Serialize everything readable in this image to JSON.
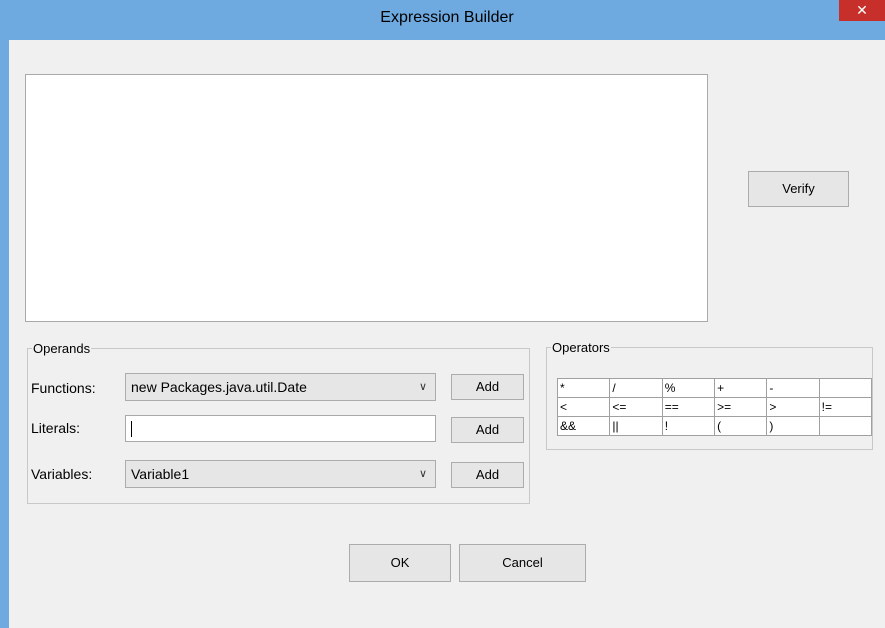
{
  "window": {
    "title": "Expression Builder",
    "close_glyph": "✕"
  },
  "expression": {
    "value": ""
  },
  "buttons": {
    "verify": "Verify",
    "ok": "OK",
    "cancel": "Cancel"
  },
  "operands": {
    "legend": "Operands",
    "functions": {
      "label": "Functions:",
      "value": "new Packages.java.util.Date",
      "add": "Add"
    },
    "literals": {
      "label": "Literals:",
      "value": "",
      "add": "Add"
    },
    "variables": {
      "label": "Variables:",
      "value": "Variable1",
      "add": "Add"
    }
  },
  "operators": {
    "legend": "Operators",
    "rows": [
      [
        "*",
        "/",
        "%",
        "+",
        "-",
        ""
      ],
      [
        "<",
        "<=",
        "==",
        ">=",
        ">",
        "!="
      ],
      [
        "&&",
        "||",
        "!",
        "(",
        ")",
        ""
      ]
    ]
  },
  "colors": {
    "titlebar": "#6ea9e0",
    "close": "#c7302a",
    "window_bg": "#f0f0f0"
  }
}
